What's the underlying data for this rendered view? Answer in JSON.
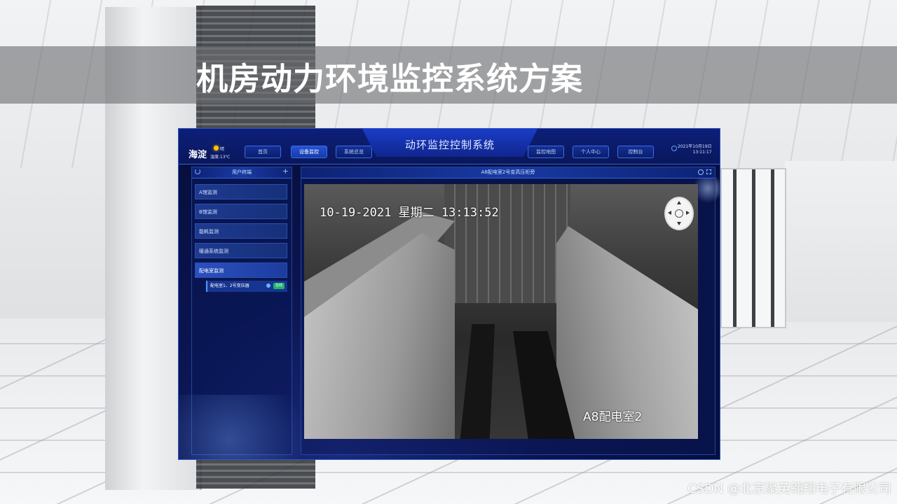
{
  "banner": {
    "title": "机房动力环境监控系统方案"
  },
  "header": {
    "location": "海淀",
    "weather": "晴",
    "temperature": "温度:13℃",
    "title": "动环监控控制系统",
    "nav": [
      {
        "label": "首页",
        "active": false
      },
      {
        "label": "设备监控",
        "active": true
      },
      {
        "label": "系统总览",
        "active": false
      },
      {
        "label": "监控地图",
        "active": false
      },
      {
        "label": "个人中心",
        "active": false
      },
      {
        "label": "控制台",
        "active": false
      }
    ],
    "date": "2021年10月19日",
    "time": "13:11:17"
  },
  "sidebar": {
    "heading": "用户终端",
    "items": [
      {
        "label": "A馆监测",
        "active": false
      },
      {
        "label": "B馆监测",
        "active": false
      },
      {
        "label": "能耗监测",
        "active": false
      },
      {
        "label": "暖通系统监测",
        "active": false
      },
      {
        "label": "配电室监测",
        "active": true
      }
    ],
    "submenu": {
      "label": "配电室1、2号变压器",
      "status": "在线"
    }
  },
  "panel": {
    "title": "A8配电室2号变高压柜旁"
  },
  "video": {
    "timestamp": "10-19-2021 星期二 13:13:52",
    "camera_label": "A8配电室2"
  },
  "icons": [
    "refresh-icon",
    "add-icon",
    "gear-icon",
    "expand-icon",
    "ptz-control-icon",
    "clock-icon",
    "weather-sun-icon"
  ],
  "watermark": "CSDN @北京聚英翱翔电子有限公司",
  "colors": {
    "accent": "#2f63e0",
    "status_online": "#1fb36a",
    "panel_bg": "#0b1550"
  }
}
